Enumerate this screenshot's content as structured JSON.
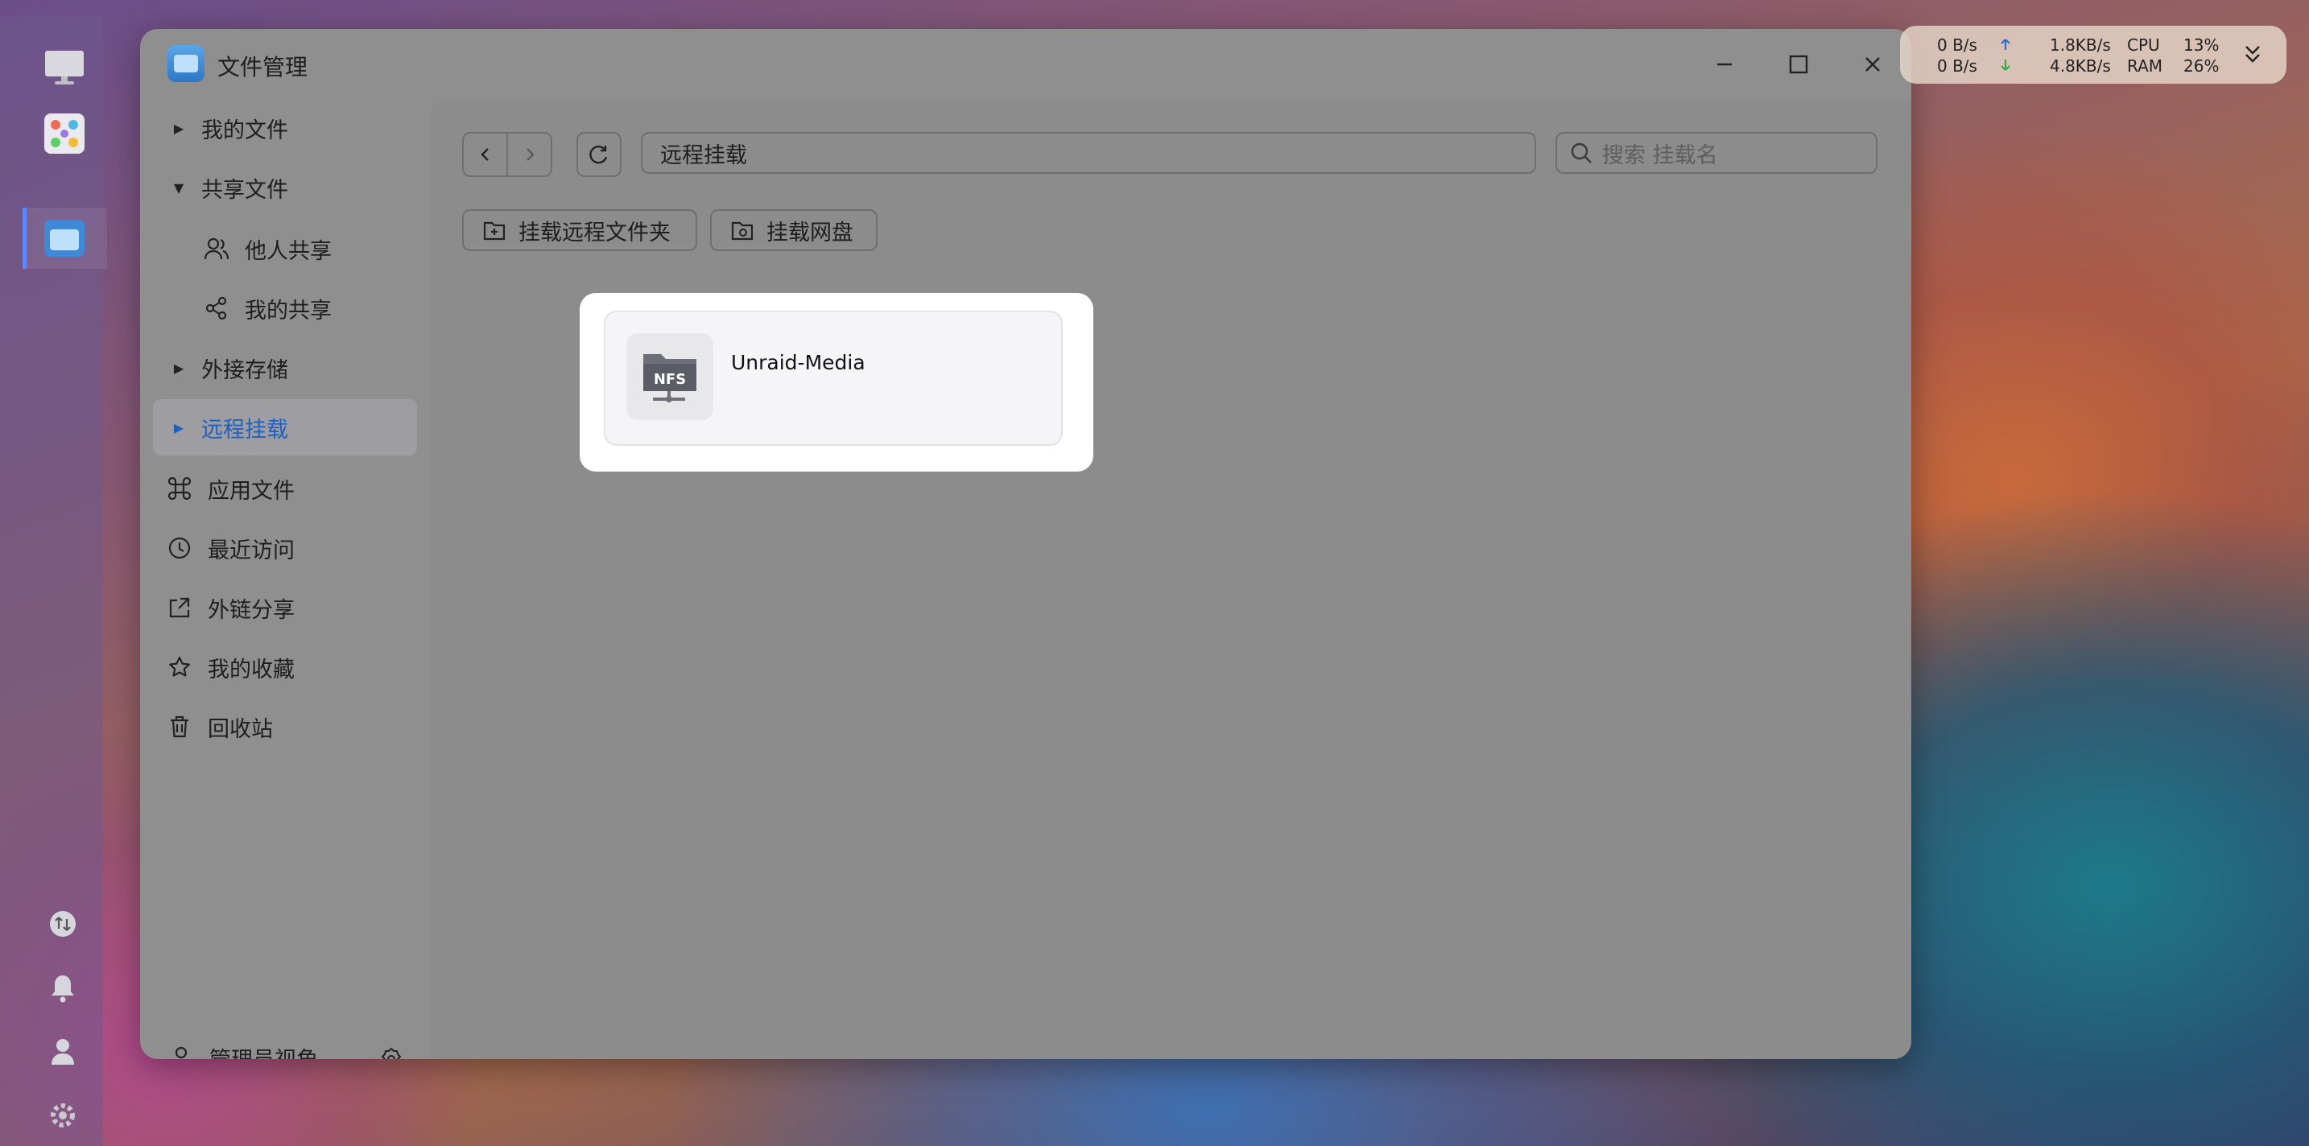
{
  "window": {
    "title": "文件管理"
  },
  "sidebar": {
    "items": [
      {
        "label": "我的文件"
      },
      {
        "label": "共享文件"
      },
      {
        "label": "他人共享"
      },
      {
        "label": "我的共享"
      },
      {
        "label": "外接存储"
      },
      {
        "label": "远程挂载"
      },
      {
        "label": "应用文件"
      },
      {
        "label": "最近访问"
      },
      {
        "label": "外链分享"
      },
      {
        "label": "我的收藏"
      },
      {
        "label": "回收站"
      }
    ],
    "footer_label": "管理员视角"
  },
  "toolbar": {
    "path": "远程挂载",
    "search_placeholder": "搜索 挂载名",
    "mount_folder_label": "挂载远程文件夹",
    "mount_drive_label": "挂载网盘"
  },
  "mounts": [
    {
      "name": "Unraid-Media",
      "badge": "NFS"
    }
  ],
  "status": {
    "up_rate": "0  B/s",
    "down_rate": "0  B/s",
    "net1": "1.8KB/s",
    "net2": "4.8KB/s",
    "cpu_label": "CPU",
    "ram_label": "RAM",
    "cpu_value": "13%",
    "ram_value": "26%"
  },
  "colors": {
    "accent": "#1f5fbf",
    "dock_indicator": "#5d88ff"
  }
}
